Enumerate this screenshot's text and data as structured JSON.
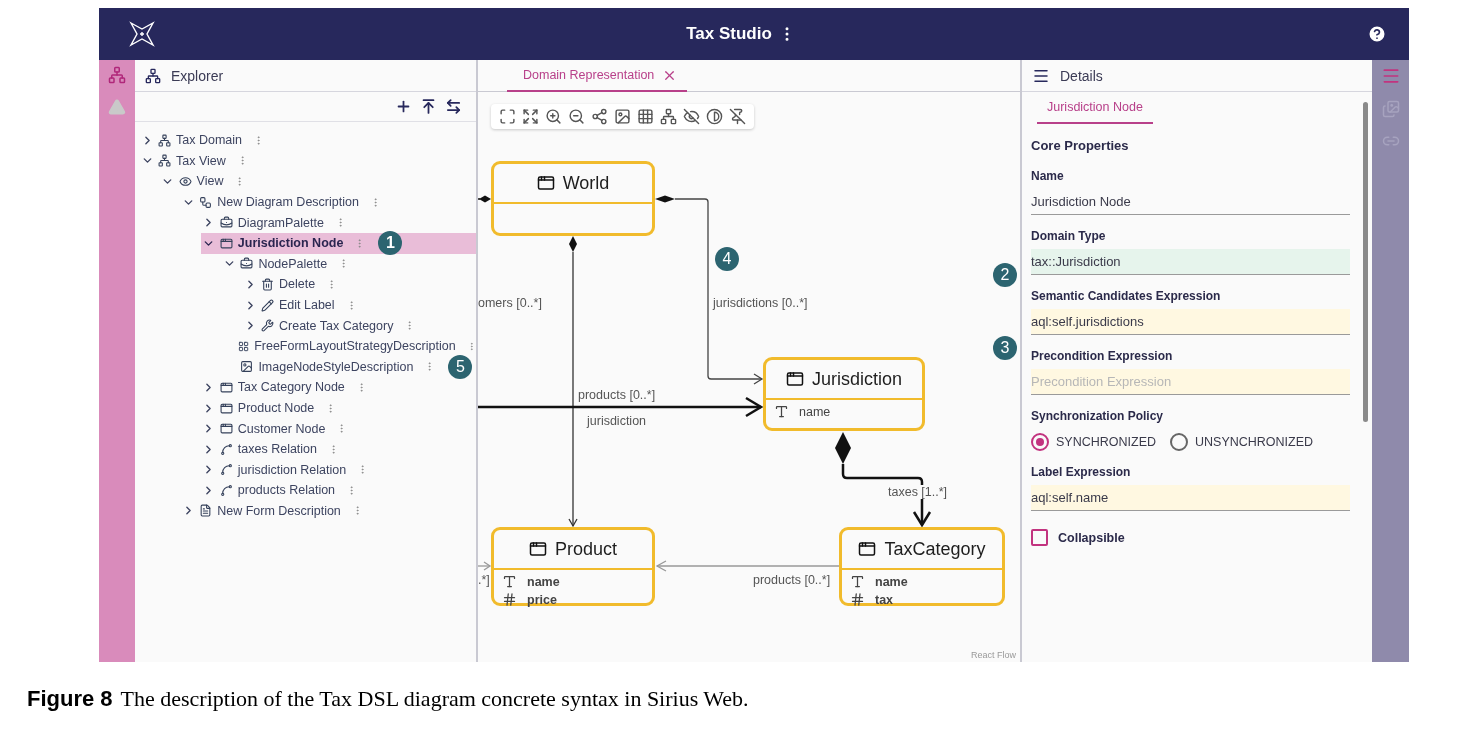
{
  "app_bar": {
    "title": "Tax Studio"
  },
  "explorer": {
    "title": "Explorer",
    "tree": [
      {
        "label": "Tax Domain",
        "kind": "model",
        "expanded": false,
        "selected": false
      },
      {
        "label": "Tax View",
        "kind": "model",
        "expanded": true,
        "selected": false,
        "children": [
          {
            "label": "View",
            "kind": "view",
            "expanded": true,
            "selected": false,
            "children": [
              {
                "label": "New Diagram Description",
                "kind": "diagram",
                "expanded": true,
                "selected": false,
                "children": [
                  {
                    "label": "DiagramPalette",
                    "kind": "palette",
                    "expanded": false,
                    "selected": false
                  },
                  {
                    "label": "Jurisdiction Node",
                    "kind": "node",
                    "expanded": true,
                    "selected": true,
                    "badge": "1",
                    "children": [
                      {
                        "label": "NodePalette",
                        "kind": "palette",
                        "expanded": true,
                        "selected": false,
                        "children": [
                          {
                            "label": "Delete",
                            "kind": "delete",
                            "expanded": false,
                            "selected": false
                          },
                          {
                            "label": "Edit Label",
                            "kind": "edit",
                            "expanded": false,
                            "selected": false
                          },
                          {
                            "label": "Create Tax Category",
                            "kind": "tool",
                            "expanded": false,
                            "selected": false
                          }
                        ]
                      },
                      {
                        "label": "FreeFormLayoutStrategyDescription",
                        "kind": "layout",
                        "selected": false
                      },
                      {
                        "label": "ImageNodeStyleDescription",
                        "kind": "image",
                        "selected": false,
                        "badge": "5"
                      }
                    ]
                  },
                  {
                    "label": "Tax Category Node",
                    "kind": "node",
                    "expanded": false,
                    "selected": false
                  },
                  {
                    "label": "Product Node",
                    "kind": "node",
                    "expanded": false,
                    "selected": false
                  },
                  {
                    "label": "Customer Node",
                    "kind": "node",
                    "expanded": false,
                    "selected": false
                  },
                  {
                    "label": "taxes Relation",
                    "kind": "edge",
                    "expanded": false,
                    "selected": false
                  },
                  {
                    "label": "jurisdiction Relation",
                    "kind": "edge",
                    "expanded": false,
                    "selected": false
                  },
                  {
                    "label": "products Relation",
                    "kind": "edge",
                    "expanded": false,
                    "selected": false
                  }
                ]
              },
              {
                "label": "New Form Description",
                "kind": "form",
                "expanded": false,
                "selected": false
              }
            ]
          }
        ]
      }
    ]
  },
  "diagram": {
    "tab": {
      "label": "Domain Representation",
      "selected": true
    },
    "nodes": [
      {
        "title": "World"
      },
      {
        "title": "Jurisdiction",
        "attributes": [
          {
            "kind": "text",
            "name": "name",
            "bold": false
          }
        ]
      },
      {
        "title": "Product",
        "attributes": [
          {
            "kind": "text",
            "name": "name",
            "bold": true
          },
          {
            "kind": "number",
            "name": "price",
            "bold": true
          }
        ]
      },
      {
        "title": "TaxCategory",
        "attributes": [
          {
            "kind": "text",
            "name": "name",
            "bold": true
          },
          {
            "kind": "number",
            "name": "tax",
            "bold": true
          }
        ]
      }
    ],
    "edge_labels": [
      "omers [0..*]",
      "jurisdictions [0..*]",
      "products [0..*]",
      "jurisdiction",
      "taxes [1..*]",
      "products [0..*]",
      ".*]"
    ],
    "badges": [
      "4",
      "2",
      "3"
    ],
    "attribution": "React Flow"
  },
  "details": {
    "title": "Details",
    "tab": {
      "label": "Jurisdiction Node",
      "selected": true
    },
    "section": "Core Properties",
    "fields": [
      {
        "kind": "text",
        "label": "Name",
        "value": "Jurisdiction Node"
      },
      {
        "kind": "text",
        "label": "Domain Type",
        "value": "tax::Jurisdiction",
        "color": "#e6f4ec"
      },
      {
        "kind": "text",
        "label": "Semantic Candidates Expression",
        "value": "aql:self.jurisdictions",
        "color": "#fff8e1"
      },
      {
        "kind": "text",
        "label": "Precondition Expression",
        "placeholder": "Precondition Expression",
        "color": "#fff8e1"
      },
      {
        "kind": "radio",
        "label": "Synchronization Policy",
        "options": [
          {
            "label": "SYNCHRONIZED",
            "selected": true
          },
          {
            "label": "UNSYNCHRONIZED",
            "selected": false
          }
        ]
      },
      {
        "kind": "text",
        "label": "Label Expression",
        "value": "aql:self.name",
        "color": "#fff8e1"
      },
      {
        "kind": "checkbox",
        "label": "Collapsible",
        "checked": false
      }
    ]
  },
  "caption": {
    "label": "Figure 8",
    "text": "The description of the Tax DSL diagram concrete syntax in Sirius Web."
  }
}
